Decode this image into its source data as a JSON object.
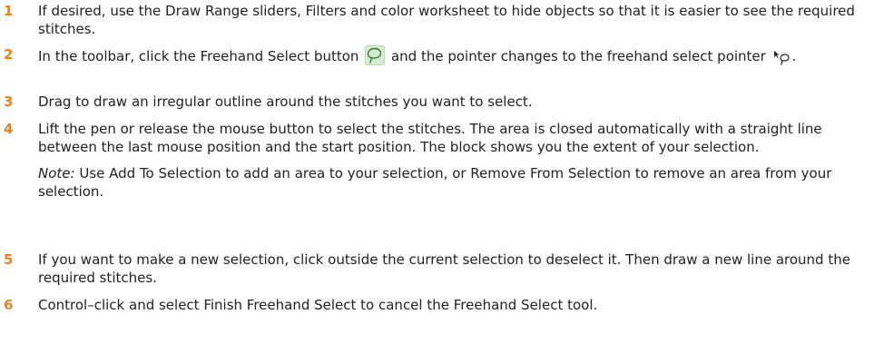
{
  "steps": [
    {
      "number": "1",
      "text": "If desired, use the Draw Range sliders, Filters and color worksheet to hide objects so that it is easier to see the required stitches."
    },
    {
      "number": "2",
      "text_before_icon": "In the toolbar, click the Freehand Select button",
      "text_after_icon": "and the pointer changes to the freehand select pointer",
      "icon_button": "freehand-select-icon",
      "icon_pointer": "freehand-pointer-icon",
      "text_end": "."
    },
    {
      "number": "3",
      "text": "Drag to draw an irregular outline around the stitches you want to select."
    },
    {
      "number": "4",
      "text": "Lift the pen or release the mouse button to select the stitches. The area is closed automatically with a straight line between the last mouse position and the start position. The block shows you the extent of your selection.",
      "note_label": "Note:",
      "note_text": "Use Add To Selection to add an area to your selection, or Remove From Selection to remove an area from your selection."
    },
    {
      "number": "5",
      "text": "If you want to make a new selection, click outside the current selection to deselect it. Then draw a new line around the required stitches."
    },
    {
      "number": "6",
      "text": "Control–click and select Finish Freehand Select to cancel the Freehand Select tool."
    }
  ],
  "colors": {
    "step_number": "#f07f1d",
    "text": "#222222",
    "icon_fill": "#d6ecd2",
    "icon_stroke": "#3d7a3a"
  }
}
